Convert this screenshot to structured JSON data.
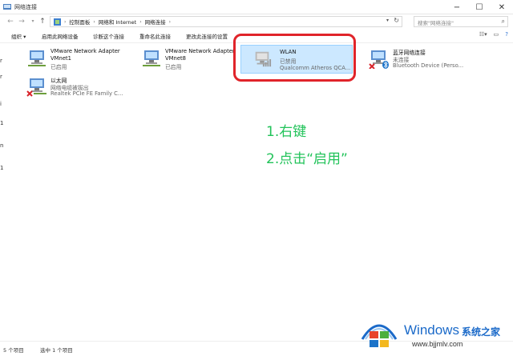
{
  "window": {
    "title": "网络连接"
  },
  "address": {
    "path": [
      "控制面板",
      "网络和 Internet",
      "网络连接"
    ],
    "search_placeholder": "搜索\"网络连接\""
  },
  "commands": [
    "组织 ▾",
    "启用此网络设备",
    "诊断这个连接",
    "重命名此连接",
    "更改此连接的设置"
  ],
  "items": [
    {
      "name": "VMware Network Adapter",
      "name2": "VMnet1",
      "status": "已启用",
      "device": ""
    },
    {
      "name": "VMware Network Adapter",
      "name2": "VMnet8",
      "status": "已启用",
      "device": ""
    },
    {
      "name": "WLAN",
      "name2": "",
      "status": "已禁用",
      "device": "Qualcomm Atheros QCA..."
    },
    {
      "name": "蓝牙网络连接",
      "name2": "",
      "status": "未连接",
      "device": "Bluetooth Device (Perso..."
    },
    {
      "name": "以太网",
      "name2": "",
      "status": "网络电缆被拔出",
      "device": "Realtek PCIe FE Family C..."
    }
  ],
  "annotations": {
    "step1": "1.右键",
    "step2": "2.点击“启用”"
  },
  "status": {
    "count": "5 个项目",
    "selected": "选中 1 个项目"
  },
  "watermark": {
    "brand": "Windows",
    "cn": "系统之家",
    "url": "www.bjjmlv.com"
  },
  "colors": {
    "selection": "#cce8ff",
    "annotation": "#22c35a",
    "highlight_border": "#e0242a",
    "watermark": "#1b6ac9"
  }
}
